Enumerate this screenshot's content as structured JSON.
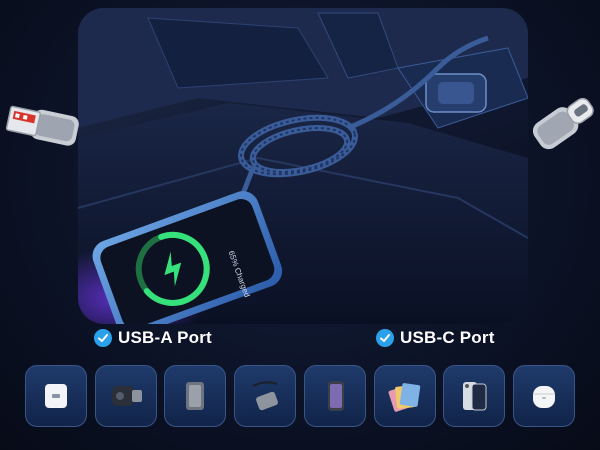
{
  "labels": {
    "usb_a": "USB-A Port",
    "usb_c": "USB-C Port"
  },
  "phone_screen_text": "65% Charged",
  "icons": {
    "check": "checkmark-icon",
    "charge": "lightning-icon"
  },
  "devices": [
    {
      "name": "wall-charger"
    },
    {
      "name": "car-charger"
    },
    {
      "name": "power-bank"
    },
    {
      "name": "usb-hub"
    },
    {
      "name": "smartphone"
    },
    {
      "name": "tablets"
    },
    {
      "name": "phone"
    },
    {
      "name": "earbuds"
    }
  ],
  "colors": {
    "background": "#0c1327",
    "accent_blue": "#2aa1ea",
    "charge_green": "#36e07a",
    "tile": "#1f3a6b",
    "text": "#ffffff"
  }
}
